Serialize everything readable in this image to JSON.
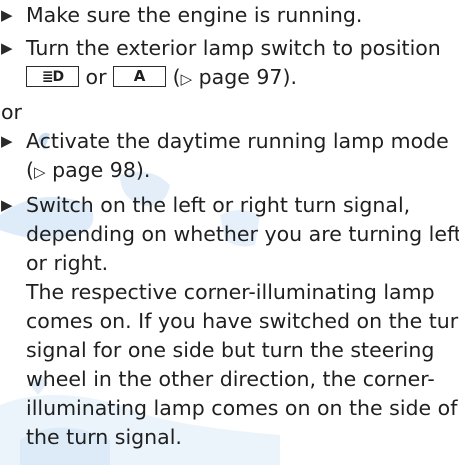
{
  "steps": [
    {
      "bullet": "▶",
      "lines": [
        "Make sure the engine is running."
      ]
    },
    {
      "bullet": "▶",
      "line1": "Turn the exterior lamp switch to position",
      "box1_glyph": "≣D",
      "or_inline": "or",
      "box2_label": "A",
      "ref_open": "(",
      "ref_arrow": "▷",
      "ref_text": " page 97)."
    }
  ],
  "or_separator": "or",
  "step3": {
    "bullet": "▶",
    "line1": "Activate the daytime running lamp mode",
    "ref_open": "(",
    "ref_arrow": "▷",
    "ref_text": " page 98)."
  },
  "step4": {
    "bullet": "▶",
    "lines": [
      "Switch on the left or right turn signal,",
      "depending on whether you are turning left",
      "or right."
    ]
  },
  "result": {
    "lines": [
      "The respective corner-illuminating lamp",
      "comes on. If you have switched on the turn",
      "signal for one side but turn the steering",
      "wheel in the other direction, the corner-",
      "illuminating lamp comes on on the side of",
      "the turn signal."
    ]
  },
  "colors": {
    "text": "#1f1f1f",
    "watermark": "#9cc3ea"
  }
}
